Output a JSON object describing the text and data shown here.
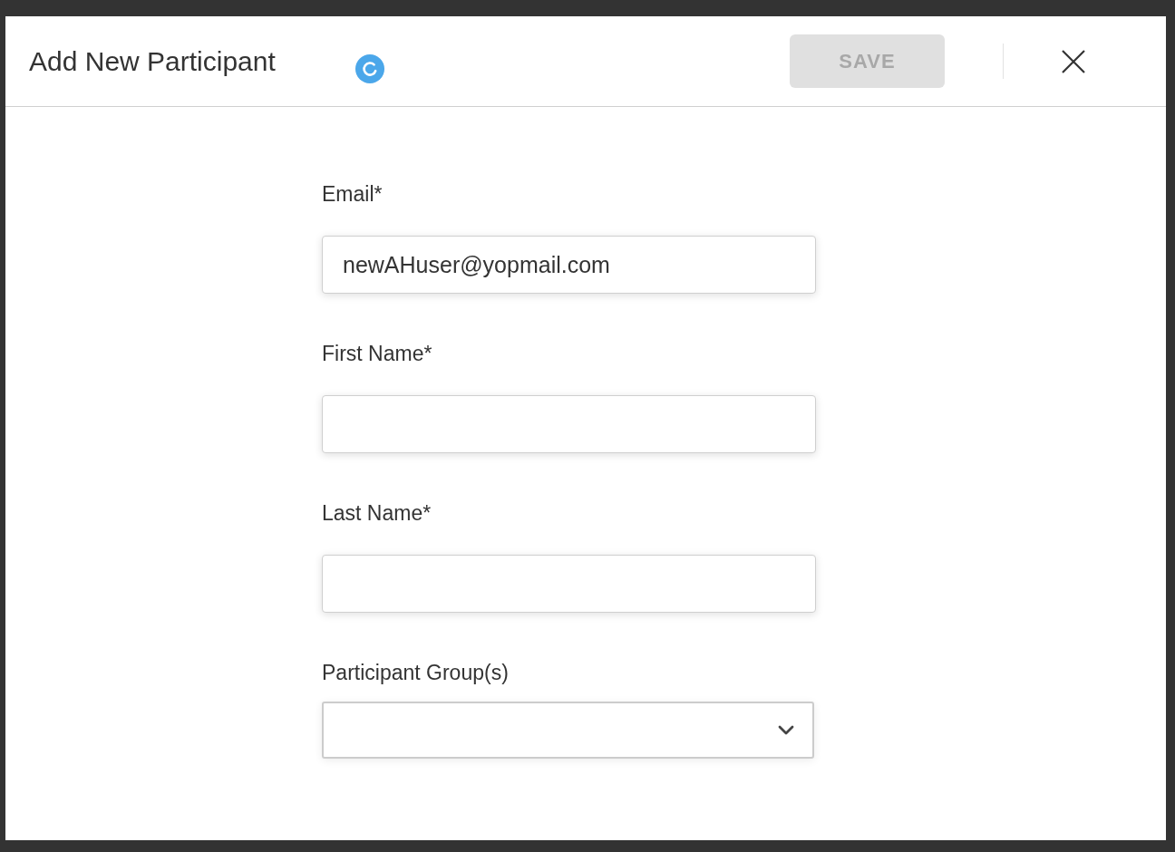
{
  "dialog": {
    "title": "Add New Participant",
    "loading": true,
    "save_button": {
      "label": "SAVE",
      "disabled": true
    }
  },
  "fields": [
    {
      "kind": "text",
      "label": "Email*",
      "value": "newAHuser@yopmail.com"
    },
    {
      "kind": "text",
      "label": "First Name*"
    },
    {
      "kind": "text",
      "label": "Last Name*"
    },
    {
      "kind": "select",
      "label": "Participant Group(s)"
    }
  ]
}
